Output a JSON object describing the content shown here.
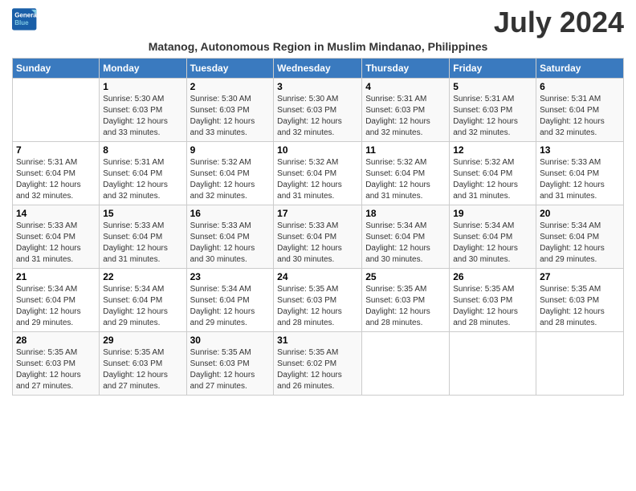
{
  "logo": {
    "line1": "General",
    "line2": "Blue"
  },
  "title": "July 2024",
  "subtitle": "Matanog, Autonomous Region in Muslim Mindanao, Philippines",
  "days_of_week": [
    "Sunday",
    "Monday",
    "Tuesday",
    "Wednesday",
    "Thursday",
    "Friday",
    "Saturday"
  ],
  "weeks": [
    [
      {
        "day": "",
        "info": ""
      },
      {
        "day": "1",
        "info": "Sunrise: 5:30 AM\nSunset: 6:03 PM\nDaylight: 12 hours\nand 33 minutes."
      },
      {
        "day": "2",
        "info": "Sunrise: 5:30 AM\nSunset: 6:03 PM\nDaylight: 12 hours\nand 33 minutes."
      },
      {
        "day": "3",
        "info": "Sunrise: 5:30 AM\nSunset: 6:03 PM\nDaylight: 12 hours\nand 32 minutes."
      },
      {
        "day": "4",
        "info": "Sunrise: 5:31 AM\nSunset: 6:03 PM\nDaylight: 12 hours\nand 32 minutes."
      },
      {
        "day": "5",
        "info": "Sunrise: 5:31 AM\nSunset: 6:03 PM\nDaylight: 12 hours\nand 32 minutes."
      },
      {
        "day": "6",
        "info": "Sunrise: 5:31 AM\nSunset: 6:04 PM\nDaylight: 12 hours\nand 32 minutes."
      }
    ],
    [
      {
        "day": "7",
        "info": "Sunrise: 5:31 AM\nSunset: 6:04 PM\nDaylight: 12 hours\nand 32 minutes."
      },
      {
        "day": "8",
        "info": "Sunrise: 5:31 AM\nSunset: 6:04 PM\nDaylight: 12 hours\nand 32 minutes."
      },
      {
        "day": "9",
        "info": "Sunrise: 5:32 AM\nSunset: 6:04 PM\nDaylight: 12 hours\nand 32 minutes."
      },
      {
        "day": "10",
        "info": "Sunrise: 5:32 AM\nSunset: 6:04 PM\nDaylight: 12 hours\nand 31 minutes."
      },
      {
        "day": "11",
        "info": "Sunrise: 5:32 AM\nSunset: 6:04 PM\nDaylight: 12 hours\nand 31 minutes."
      },
      {
        "day": "12",
        "info": "Sunrise: 5:32 AM\nSunset: 6:04 PM\nDaylight: 12 hours\nand 31 minutes."
      },
      {
        "day": "13",
        "info": "Sunrise: 5:33 AM\nSunset: 6:04 PM\nDaylight: 12 hours\nand 31 minutes."
      }
    ],
    [
      {
        "day": "14",
        "info": "Sunrise: 5:33 AM\nSunset: 6:04 PM\nDaylight: 12 hours\nand 31 minutes."
      },
      {
        "day": "15",
        "info": "Sunrise: 5:33 AM\nSunset: 6:04 PM\nDaylight: 12 hours\nand 31 minutes."
      },
      {
        "day": "16",
        "info": "Sunrise: 5:33 AM\nSunset: 6:04 PM\nDaylight: 12 hours\nand 30 minutes."
      },
      {
        "day": "17",
        "info": "Sunrise: 5:33 AM\nSunset: 6:04 PM\nDaylight: 12 hours\nand 30 minutes."
      },
      {
        "day": "18",
        "info": "Sunrise: 5:34 AM\nSunset: 6:04 PM\nDaylight: 12 hours\nand 30 minutes."
      },
      {
        "day": "19",
        "info": "Sunrise: 5:34 AM\nSunset: 6:04 PM\nDaylight: 12 hours\nand 30 minutes."
      },
      {
        "day": "20",
        "info": "Sunrise: 5:34 AM\nSunset: 6:04 PM\nDaylight: 12 hours\nand 29 minutes."
      }
    ],
    [
      {
        "day": "21",
        "info": "Sunrise: 5:34 AM\nSunset: 6:04 PM\nDaylight: 12 hours\nand 29 minutes."
      },
      {
        "day": "22",
        "info": "Sunrise: 5:34 AM\nSunset: 6:04 PM\nDaylight: 12 hours\nand 29 minutes."
      },
      {
        "day": "23",
        "info": "Sunrise: 5:34 AM\nSunset: 6:04 PM\nDaylight: 12 hours\nand 29 minutes."
      },
      {
        "day": "24",
        "info": "Sunrise: 5:35 AM\nSunset: 6:03 PM\nDaylight: 12 hours\nand 28 minutes."
      },
      {
        "day": "25",
        "info": "Sunrise: 5:35 AM\nSunset: 6:03 PM\nDaylight: 12 hours\nand 28 minutes."
      },
      {
        "day": "26",
        "info": "Sunrise: 5:35 AM\nSunset: 6:03 PM\nDaylight: 12 hours\nand 28 minutes."
      },
      {
        "day": "27",
        "info": "Sunrise: 5:35 AM\nSunset: 6:03 PM\nDaylight: 12 hours\nand 28 minutes."
      }
    ],
    [
      {
        "day": "28",
        "info": "Sunrise: 5:35 AM\nSunset: 6:03 PM\nDaylight: 12 hours\nand 27 minutes."
      },
      {
        "day": "29",
        "info": "Sunrise: 5:35 AM\nSunset: 6:03 PM\nDaylight: 12 hours\nand 27 minutes."
      },
      {
        "day": "30",
        "info": "Sunrise: 5:35 AM\nSunset: 6:03 PM\nDaylight: 12 hours\nand 27 minutes."
      },
      {
        "day": "31",
        "info": "Sunrise: 5:35 AM\nSunset: 6:02 PM\nDaylight: 12 hours\nand 26 minutes."
      },
      {
        "day": "",
        "info": ""
      },
      {
        "day": "",
        "info": ""
      },
      {
        "day": "",
        "info": ""
      }
    ]
  ]
}
